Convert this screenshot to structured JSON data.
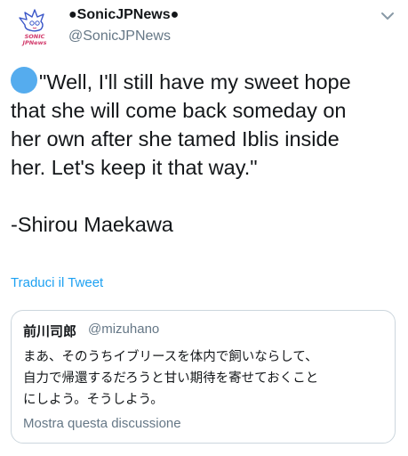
{
  "tweet": {
    "author": {
      "display_name": "●SonicJPNews●",
      "handle": "@SonicJPNews",
      "avatar_text": [
        "SONIC",
        "JPNews"
      ],
      "avatar_icon": "sonic-doodle-avatar"
    },
    "menu_icon": "chevron-down-icon",
    "text_lines": [
      "\"Well, I'll still have my sweet hope",
      "that she will come back someday on",
      "her own after she tamed Iblis inside",
      "her. Let's keep it that way.\"",
      "",
      "-Shirou Maekawa"
    ],
    "emoji": "blue-circle",
    "translate_label": "Traduci il Tweet"
  },
  "quote": {
    "display_name": "前川司郎",
    "handle": "@mizuhano",
    "text_lines": [
      "まあ、そのうちイブリースを体内で飼いならして、",
      "自力で帰還するだろうと甘い期待を寄せておくこと",
      "にしよう。そうしよう。"
    ],
    "show_thread_label": "Mostra questa discussione"
  },
  "colors": {
    "text": "#14171a",
    "secondary": "#657786",
    "link": "#1da1f2",
    "border": "#ccd6dd",
    "emoji_blue": "#55acee"
  }
}
